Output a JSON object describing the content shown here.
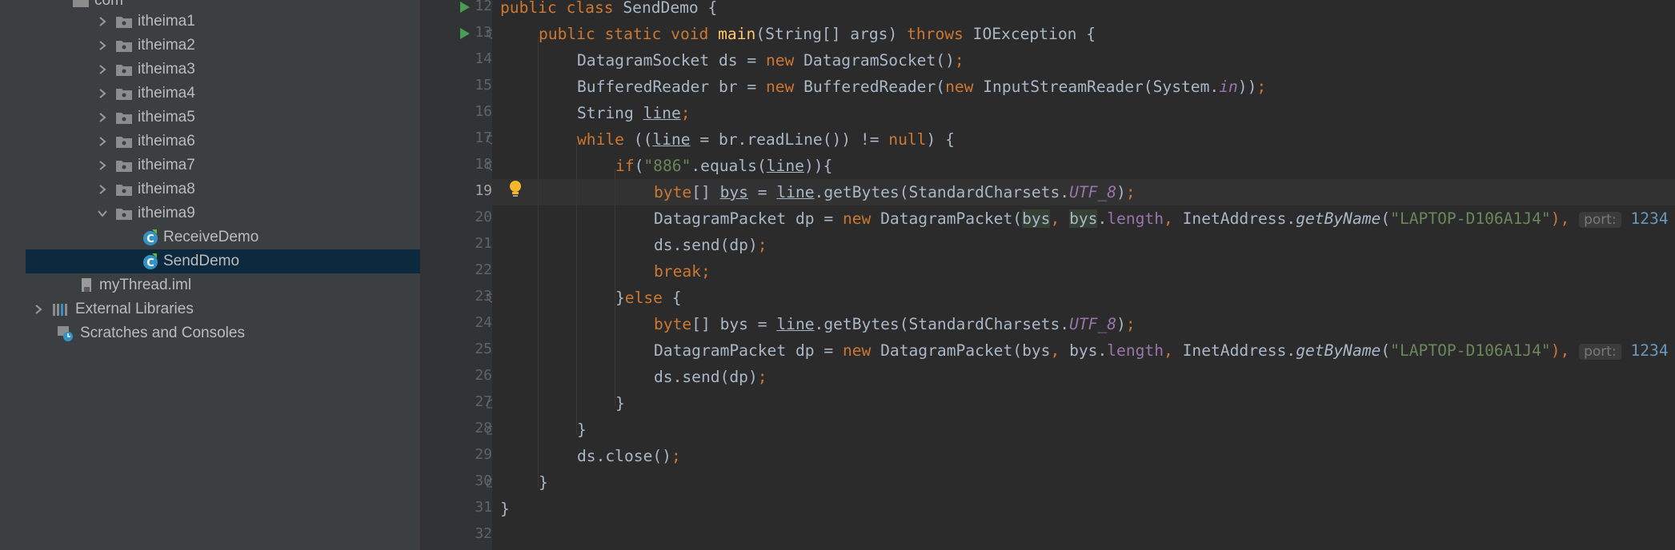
{
  "project_tree": {
    "partial_top_label": "com",
    "items": [
      {
        "label": "itheima1",
        "type": "package",
        "expanded": false
      },
      {
        "label": "itheima2",
        "type": "package",
        "expanded": false
      },
      {
        "label": "itheima3",
        "type": "package",
        "expanded": false
      },
      {
        "label": "itheima4",
        "type": "package",
        "expanded": false
      },
      {
        "label": "itheima5",
        "type": "package",
        "expanded": false
      },
      {
        "label": "itheima6",
        "type": "package",
        "expanded": false
      },
      {
        "label": "itheima7",
        "type": "package",
        "expanded": false
      },
      {
        "label": "itheima8",
        "type": "package",
        "expanded": false
      },
      {
        "label": "itheima9",
        "type": "package",
        "expanded": true
      },
      {
        "label": "ReceiveDemo",
        "type": "java-class"
      },
      {
        "label": "SendDemo",
        "type": "java-class",
        "selected": true
      },
      {
        "label": "myThread.iml",
        "type": "iml-file"
      },
      {
        "label": "External Libraries",
        "type": "libraries",
        "expanded": false
      },
      {
        "label": "Scratches and Consoles",
        "type": "scratches"
      }
    ]
  },
  "editor": {
    "current_line": 19,
    "line_numbers": [
      "12",
      "13",
      "14",
      "15",
      "16",
      "17",
      "18",
      "19",
      "20",
      "21",
      "22",
      "23",
      "24",
      "25",
      "26",
      "27",
      "28",
      "29",
      "30",
      "31",
      "32"
    ],
    "code": {
      "l12": {
        "kw1": "public class ",
        "cls": "SendDemo {"
      },
      "l13": {
        "kw1": "public static void ",
        "fn": "main",
        "p1": "(String[] args) ",
        "kw2": "throws ",
        "p2": "IOException {"
      },
      "l14": {
        "p1": "DatagramSocket ds = ",
        "kw1": "new ",
        "p2": "DatagramSocket()",
        "semi": ";"
      },
      "l15": {
        "p1": "BufferedReader br = ",
        "kw1": "new ",
        "p2": "BufferedReader(",
        "kw2": "new ",
        "p3": "InputStreamReader(System.",
        "fld": "in",
        "p4": "))",
        "semi": ";"
      },
      "l16": {
        "p1": "String ",
        "var": "line",
        "semi": ";"
      },
      "l17": {
        "kw1": "while ",
        "p1": "((",
        "var": "line",
        "p2": " = br.readLine()) != ",
        "kw2": "null",
        "p3": ") {"
      },
      "l18": {
        "kw1": "if",
        "p1": "(",
        "str": "\"886\"",
        "p2": ".equals(",
        "var": "line",
        "p3": ")){"
      },
      "l19": {
        "kw1": "byte",
        "p1": "[] ",
        "var1": "bys",
        "p2": " = ",
        "var2": "line",
        "p3": ".getBytes(StandardCharsets.",
        "fld": "UTF_8",
        "p4": ")",
        "semi": ";"
      },
      "l20": {
        "p1": "DatagramPacket dp = ",
        "kw1": "new ",
        "p2": "DatagramPacket(",
        "hl1": "bys",
        "c1": ", ",
        "hl2": "bys",
        "p3": ".",
        "fld": "length",
        "c2": ", ",
        "p4": "InetAddress.",
        "m": "getByName",
        "p5": "(",
        "str": "\"LAPTOP-D106A1J4\"",
        "p6": "), ",
        "hint": "port:",
        "num": "1234"
      },
      "l21": {
        "p1": "ds.send(dp)",
        "semi": ";"
      },
      "l22": {
        "kw1": "break",
        "semi": ";"
      },
      "l23": {
        "p1": "}",
        "kw1": "else ",
        "p2": "{"
      },
      "l24": {
        "kw1": "byte",
        "p1": "[] bys = ",
        "var": "line",
        "p2": ".getBytes(StandardCharsets.",
        "fld": "UTF_8",
        "p3": ")",
        "semi": ";"
      },
      "l25": {
        "p1": "DatagramPacket dp = ",
        "kw1": "new ",
        "p2": "DatagramPacket(bys",
        "c1": ", ",
        "p3": "bys.",
        "fld": "length",
        "c2": ", ",
        "p4": "InetAddress.",
        "m": "getByName",
        "p5": "(",
        "str": "\"LAPTOP-D106A1J4\"",
        "p6": "), ",
        "hint": "port:",
        "num": "1234"
      },
      "l26": {
        "p1": "ds.send(dp)",
        "semi": ";"
      },
      "l27": {
        "p1": "}"
      },
      "l28": {
        "p1": "}"
      },
      "l29": {
        "p1": "ds.close()",
        "semi": ";"
      },
      "l30": {
        "p1": "}"
      },
      "l31": {
        "p1": "}"
      }
    }
  },
  "colors": {
    "editor_bg": "#2b2b2b",
    "tree_bg": "#3c3f41",
    "selected_row": "#0d293e",
    "keyword": "#cc7832",
    "string": "#6a8759",
    "field": "#9876aa",
    "method_decl": "#ffc66d"
  }
}
